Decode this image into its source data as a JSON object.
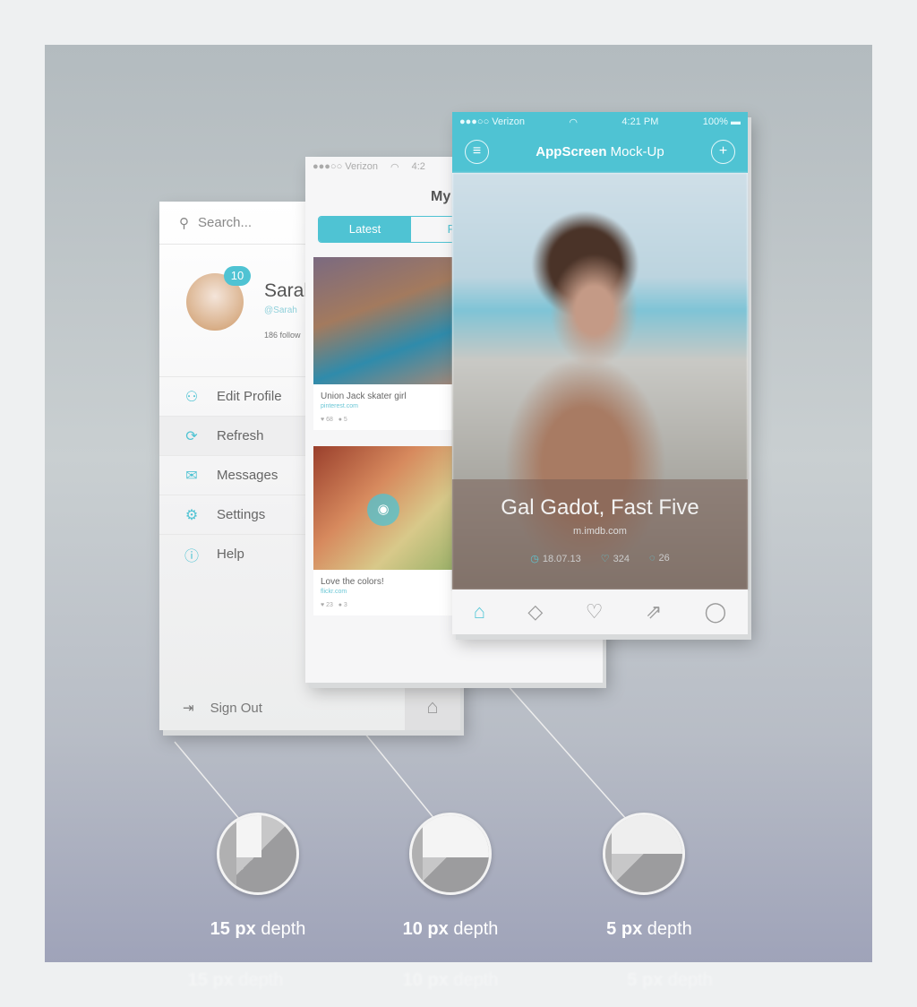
{
  "left_screen": {
    "search_placeholder": "Search...",
    "badge": "10",
    "name": "Saral",
    "handle": "@Sarah",
    "followers": "186 follow",
    "menu": [
      {
        "label": "Edit Profile",
        "icon": "user-icon"
      },
      {
        "label": "Refresh",
        "icon": "refresh-icon"
      },
      {
        "label": "Messages",
        "icon": "mail-icon"
      },
      {
        "label": "Settings",
        "icon": "gear-icon"
      },
      {
        "label": "Help",
        "icon": "help-icon"
      }
    ],
    "sign_out": "Sign Out"
  },
  "middle_screen": {
    "carrier": "●●●○○ Verizon",
    "time": "4:2",
    "title": "My",
    "tabs": [
      "Latest",
      "Fav"
    ],
    "cards": [
      {
        "title": "Union Jack skater girl",
        "source": "pinterest.com",
        "likes": "68",
        "comments": "5"
      },
      {
        "title": "Love the colors!",
        "source": "flickr.com",
        "likes": "23",
        "comments": "3"
      }
    ]
  },
  "front_screen": {
    "carrier": "●●●○○ Verizon",
    "time": "4:21 PM",
    "battery": "100%",
    "title_bold": "AppScreen",
    "title_rest": " Mock-Up",
    "caption": "Gal Gadot, Fast Five",
    "url": "m.imdb.com",
    "date": "18.07.13",
    "likes": "324",
    "comments": "26",
    "tabs": [
      "home-icon",
      "tag-icon",
      "heart-icon",
      "share-icon",
      "chat-icon"
    ]
  },
  "accent": "#4fc3d3",
  "depths": [
    {
      "value": "15 px",
      "unit": " depth"
    },
    {
      "value": "10 px",
      "unit": " depth"
    },
    {
      "value": "5 px",
      "unit": " depth"
    }
  ]
}
